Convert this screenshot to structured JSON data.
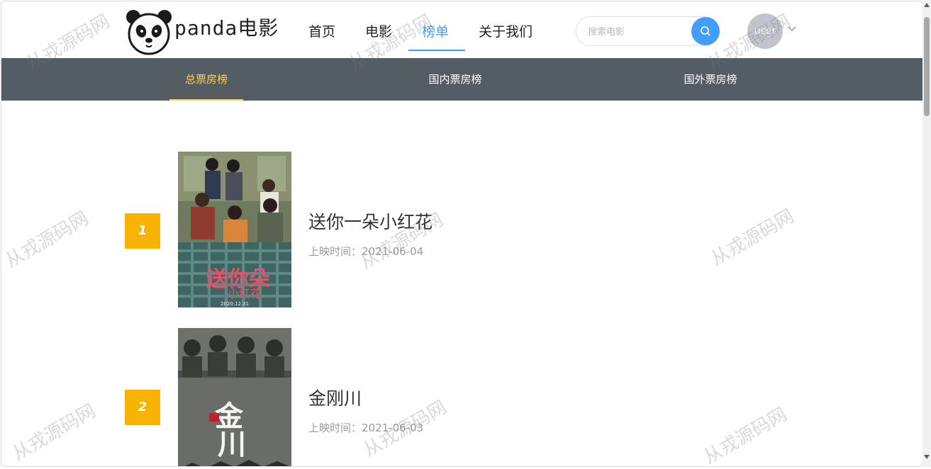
{
  "header": {
    "logo_text": "panda电影",
    "nav": [
      {
        "label": "首页"
      },
      {
        "label": "电影"
      },
      {
        "label": "榜单"
      },
      {
        "label": "关于我们"
      }
    ],
    "search": {
      "placeholder": "搜索电影",
      "value": ""
    },
    "user_label": "user"
  },
  "tabs": [
    {
      "label": "总票房榜"
    },
    {
      "label": "国内票房榜"
    },
    {
      "label": "国外票房榜"
    }
  ],
  "ranking": [
    {
      "rank": "1",
      "title": "送你一朵小红花",
      "date": "上映时间：2021-06-04",
      "poster_date": "2020.12.31"
    },
    {
      "rank": "2",
      "title": "金刚川",
      "date": "上映时间：2021-06-03"
    }
  ],
  "watermark": "从戎源码网",
  "colors": {
    "accent": "#409eff",
    "subnav_bg": "#545c64",
    "subnav_active": "#ffd04b",
    "badge": "#f8b300"
  },
  "icons": {
    "search": "search-icon",
    "caret": "chevron-down-icon",
    "logo": "panda-icon"
  }
}
